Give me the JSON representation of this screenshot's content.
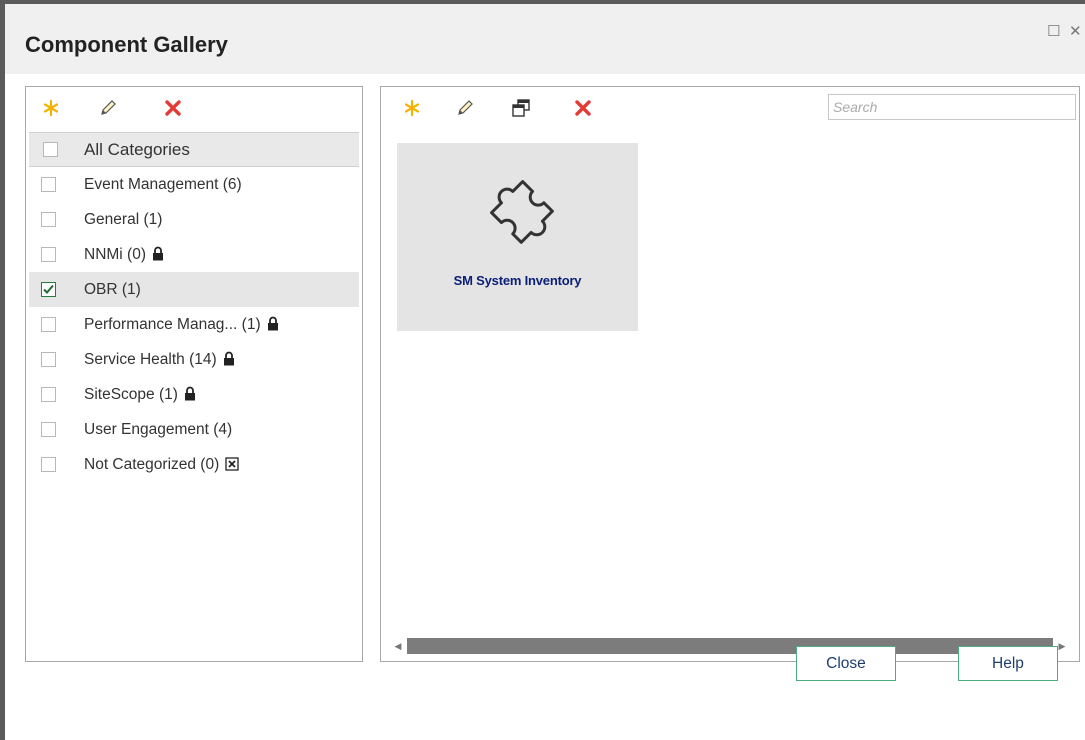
{
  "window": {
    "title": "Component Gallery",
    "maximize_glyph": "☐",
    "close_glyph": "✕"
  },
  "categories": {
    "toolbar": {
      "new_icon": "asterisk-icon",
      "edit_icon": "pencil-icon",
      "delete_icon": "delete-icon"
    },
    "all_label": "All Categories",
    "items": [
      {
        "label": "Event Management (6)",
        "checked": false,
        "icon": ""
      },
      {
        "label": "General (1)",
        "checked": false,
        "icon": ""
      },
      {
        "label": "NNMi (0)",
        "checked": false,
        "icon": "lock-icon"
      },
      {
        "label": "OBR (1)",
        "checked": true,
        "icon": ""
      },
      {
        "label": "Performance Manag... (1)",
        "checked": false,
        "icon": "lock-icon"
      },
      {
        "label": "Service Health (14)",
        "checked": false,
        "icon": "lock-icon"
      },
      {
        "label": "SiteScope (1)",
        "checked": false,
        "icon": "lock-icon"
      },
      {
        "label": "User Engagement (4)",
        "checked": false,
        "icon": ""
      },
      {
        "label": "Not Categorized (0)",
        "checked": false,
        "icon": "boxed-x-icon"
      }
    ]
  },
  "components": {
    "toolbar": {
      "new_icon": "asterisk-icon",
      "edit_icon": "pencil-icon",
      "duplicate_icon": "duplicate-icon",
      "delete_icon": "delete-icon"
    },
    "search_placeholder": "Search",
    "tiles": [
      {
        "label": "SM System Inventory",
        "icon": "puzzle-icon"
      }
    ]
  },
  "buttons": {
    "close": "Close",
    "help": "Help"
  },
  "colors": {
    "accent_border": "#4cae80",
    "delete_red": "#e53935",
    "new_yellow": "#f2b400",
    "tile_text": "#0a1f78"
  }
}
